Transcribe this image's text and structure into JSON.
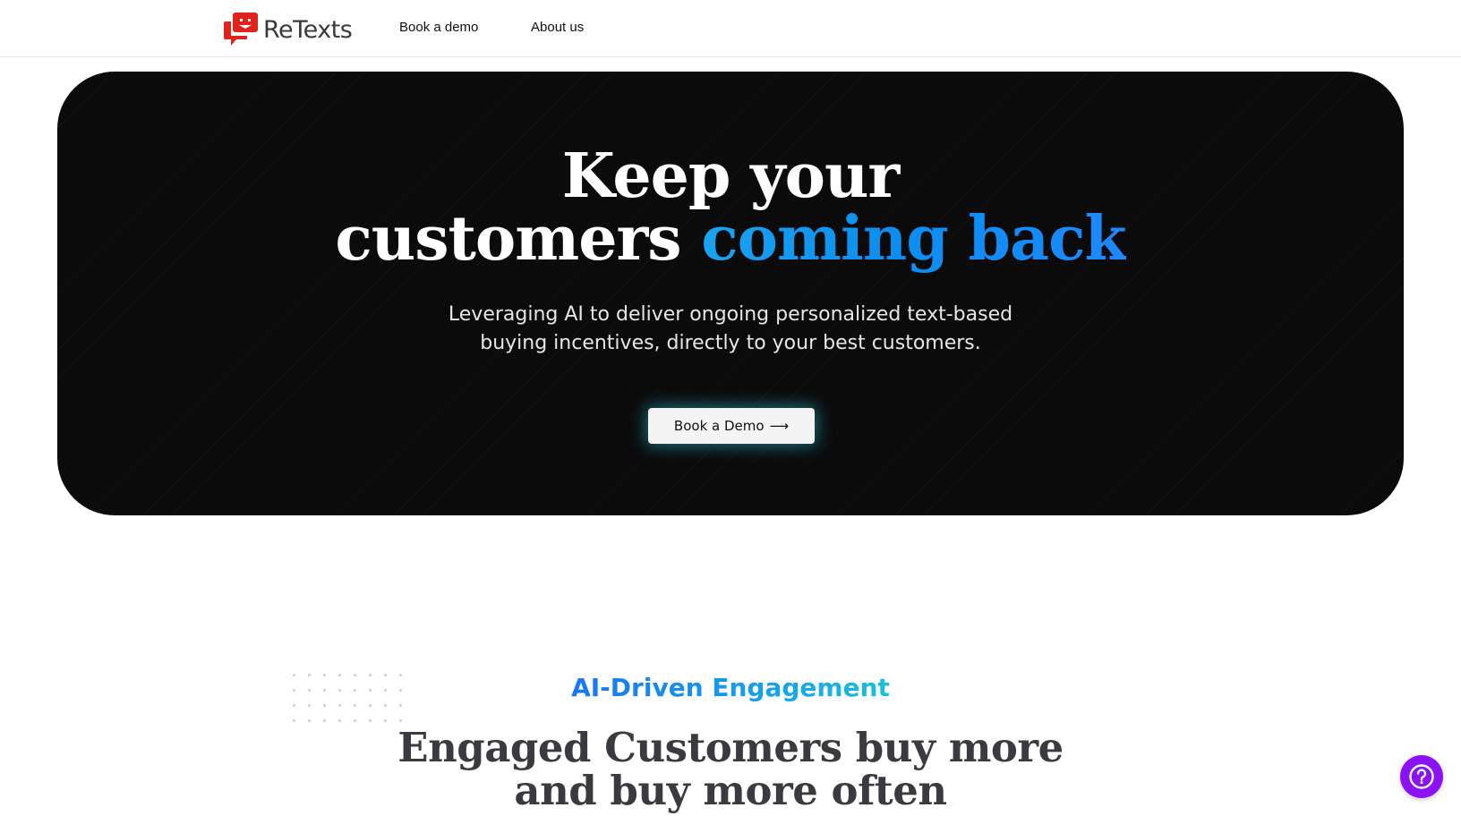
{
  "header": {
    "brand": "ReTexts",
    "nav": [
      {
        "label": "Book a demo"
      },
      {
        "label": "About us"
      }
    ]
  },
  "hero": {
    "title_line1": "Keep your",
    "title_line2_plain": "customers",
    "title_line2_accent": "coming back",
    "subtitle_line1": "Leveraging AI to deliver ongoing personalized text-based",
    "subtitle_line2": "buying incentives, directly to your best customers.",
    "cta_label": "Book a Demo",
    "cta_arrow": "⟶"
  },
  "section": {
    "eyebrow": "AI-Driven Engagement",
    "title_line1": "Engaged Customers buy more",
    "title_line2": "and buy more often"
  },
  "help_widget": {
    "icon": "question-circle-icon",
    "color": "#8a12f5"
  },
  "colors": {
    "brand_red": "#e0231b",
    "hero_bg": "#0b0b0c",
    "accent_blue": "#0b8ef0"
  }
}
